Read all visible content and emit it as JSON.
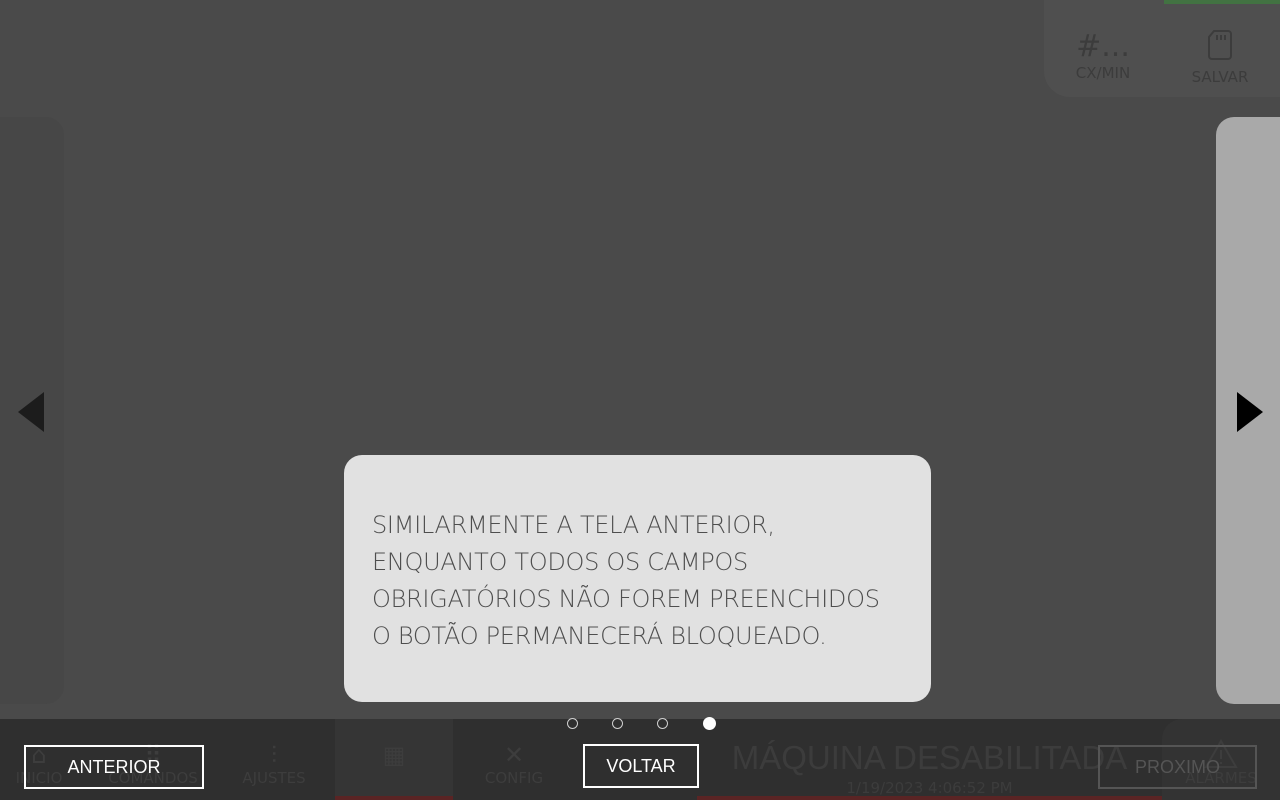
{
  "header": {
    "counter_icon": "#...",
    "counter_label": "CX/MIN",
    "save_label": "SALVAR",
    "save_icon": "sd-card-icon"
  },
  "nav": {
    "tabs": [
      {
        "label": "INICIO",
        "icon": "home-icon"
      },
      {
        "label": "COMANDOS",
        "icon": "grid-icon"
      },
      {
        "label": "AJUSTES",
        "icon": "sliders-icon"
      },
      {
        "label": "",
        "icon": "boxes-icon"
      },
      {
        "label": "CONFIG",
        "icon": "tools-icon"
      }
    ],
    "alarm_label": "ALARMES",
    "alarm_icon": "warning-icon"
  },
  "status": {
    "title": "MÁQUINA DESABILITADA",
    "timestamp": "1/19/2023 4:06:52 PM"
  },
  "tour": {
    "text_lines": [
      "SIMILARMENTE A TELA ANTERIOR,",
      "ENQUANTO TODOS OS CAMPOS",
      "OBRIGATÓRIOS NÃO FOREM PREENCHIDOS",
      "O BOTÃO PERMANECERÁ BLOQUEADO."
    ],
    "step_count": 4,
    "current_step": 4,
    "prev_label": "ANTERIOR",
    "back_label": "VOLTAR",
    "next_label": "PROXIMO"
  },
  "colors": {
    "overlay": "#4a4a4a",
    "tooltip_bg": "#e1e1e1",
    "tooltip_text": "#4e4e4e",
    "accent_red": "#5a2424"
  }
}
